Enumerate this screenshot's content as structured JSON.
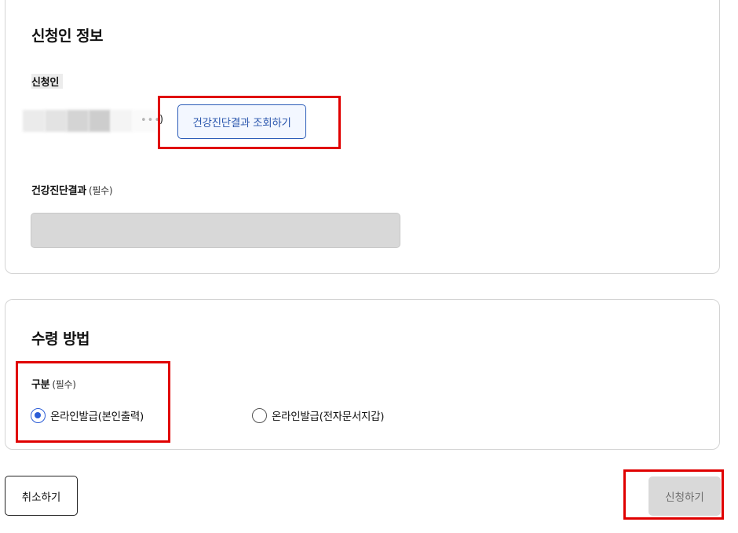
{
  "applicant_section": {
    "title": "신청인 정보",
    "applicant_label": "신청인",
    "applicant_name_suffix": ")",
    "lookup_button_label": "건강진단결과 조회하기",
    "result_label": "건강진단결과",
    "result_required": "(필수)",
    "result_value": ""
  },
  "receipt_section": {
    "title": "수령 방법",
    "category_label": "구분",
    "category_required": "(필수)",
    "options": [
      {
        "label": "온라인발급(본인출력)",
        "selected": true
      },
      {
        "label": "온라인발급(전자문서지갑)",
        "selected": false
      }
    ]
  },
  "actions": {
    "cancel_label": "취소하기",
    "apply_label": "신청하기"
  },
  "colors": {
    "accent": "#2b5cd6",
    "highlight": "#e00000",
    "disabled_bg": "#d9d9d9"
  }
}
